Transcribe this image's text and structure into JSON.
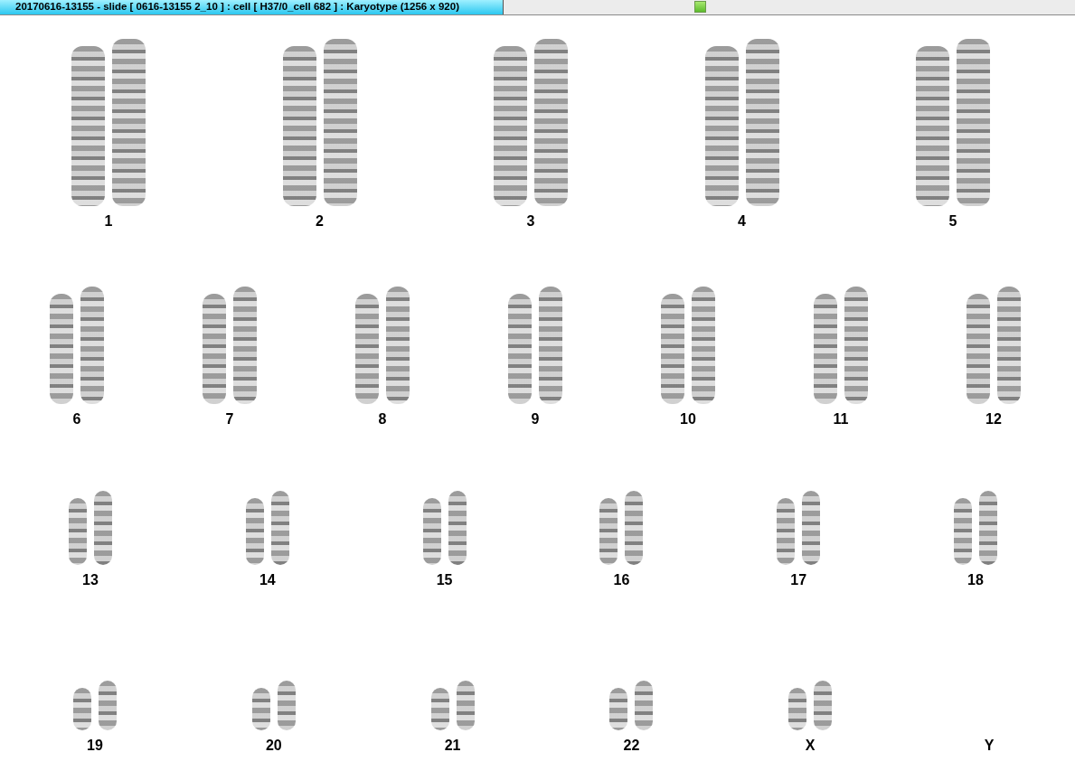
{
  "window": {
    "title": "20170616-13155 - slide [ 0616-13155 2_10 ] : cell [ H37/0_cell 682 ] : Karyotype  (1256 x 920)"
  },
  "karyotype": {
    "rows": [
      {
        "items": [
          {
            "label": "1",
            "kind": "pair"
          },
          {
            "label": "2",
            "kind": "pair"
          },
          {
            "label": "3",
            "kind": "pair"
          },
          {
            "label": "4",
            "kind": "pair"
          },
          {
            "label": "5",
            "kind": "pair"
          }
        ]
      },
      {
        "items": [
          {
            "label": "6",
            "kind": "pair"
          },
          {
            "label": "7",
            "kind": "pair"
          },
          {
            "label": "8",
            "kind": "pair"
          },
          {
            "label": "9",
            "kind": "pair"
          },
          {
            "label": "10",
            "kind": "pair"
          },
          {
            "label": "11",
            "kind": "pair"
          },
          {
            "label": "12",
            "kind": "pair"
          }
        ]
      },
      {
        "items": [
          {
            "label": "13",
            "kind": "pair"
          },
          {
            "label": "14",
            "kind": "pair"
          },
          {
            "label": "15",
            "kind": "pair"
          },
          {
            "label": "16",
            "kind": "pair"
          },
          {
            "label": "17",
            "kind": "pair"
          },
          {
            "label": "18",
            "kind": "pair"
          }
        ]
      },
      {
        "items": [
          {
            "label": "19",
            "kind": "pair"
          },
          {
            "label": "20",
            "kind": "pair"
          },
          {
            "label": "21",
            "kind": "pair"
          },
          {
            "label": "22",
            "kind": "pair"
          },
          {
            "label": "X",
            "kind": "pair"
          },
          {
            "label": "Y",
            "kind": "empty"
          }
        ]
      }
    ]
  }
}
